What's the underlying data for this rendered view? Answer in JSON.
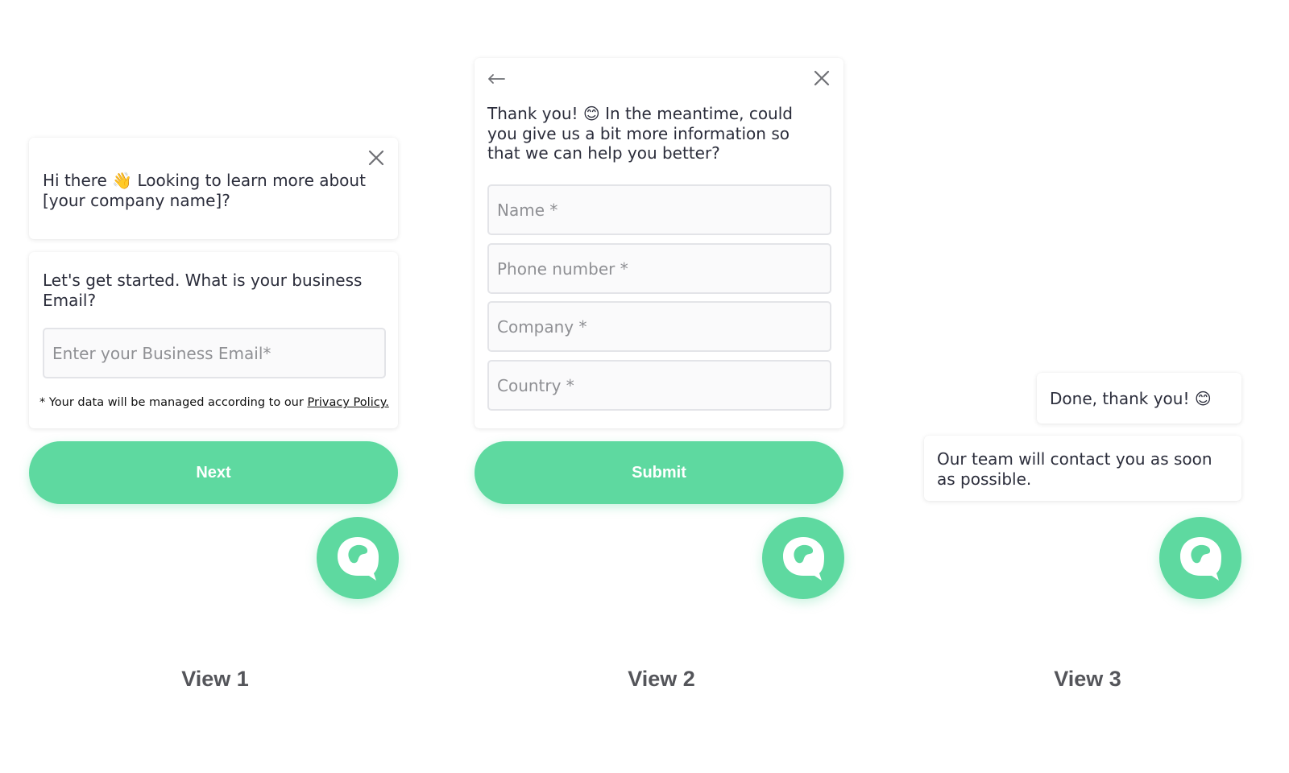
{
  "brand": {
    "accent": "#5ed9a0"
  },
  "view1": {
    "greeting_text": "Hi there 👋 Looking to learn more about [your company name]?",
    "question_text": "Let's get started. What is your business Email?",
    "email_field": {
      "placeholder": "Enter your Business Email*",
      "value": ""
    },
    "disclaimer_text": "* Your data will be managed according to our ",
    "privacy_link": "Privacy Policy.",
    "next_button": "Next",
    "label": "View 1"
  },
  "view2": {
    "message_text": "Thank you! 😊 In the meantime, could you give us a bit more information so that we can help you better?",
    "fields": [
      {
        "placeholder": "Name *",
        "value": ""
      },
      {
        "placeholder": "Phone number *",
        "value": ""
      },
      {
        "placeholder": "Company *",
        "value": ""
      },
      {
        "placeholder": "Country *",
        "value": ""
      }
    ],
    "submit_button": "Submit",
    "label": "View 2"
  },
  "view3": {
    "user_message": "Done, thank you! 😊",
    "bot_message": "Our team will contact you as soon as possible.",
    "label": "View 3"
  },
  "icons": {
    "close": "close-icon",
    "back": "back-arrow-icon",
    "chat_launcher": "chat-bubble-icon"
  }
}
